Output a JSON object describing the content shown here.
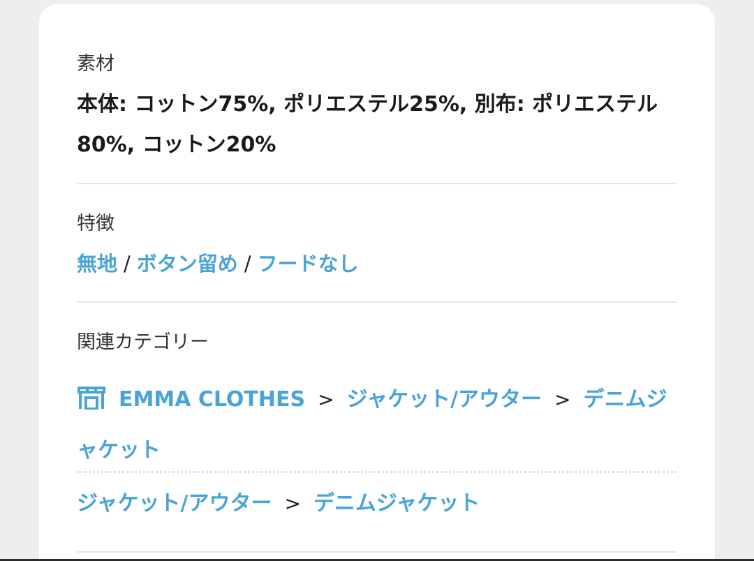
{
  "material": {
    "heading": "素材",
    "text": "本体: コットン75%, ポリエステル25%, 別布: ポリエステル80%, コットン20%"
  },
  "features": {
    "heading": "特徴",
    "tags": [
      "無地",
      "ボタン留め",
      "フードなし"
    ],
    "separator": "/"
  },
  "related": {
    "heading": "関連カテゴリー",
    "breadcrumb1": [
      "EMMA CLOTHES",
      "ジャケット/アウター",
      "デニムジャケット"
    ],
    "breadcrumb2": [
      "ジャケット/アウター",
      "デニムジャケット"
    ],
    "chevron": ">",
    "shop_icon": "shop-icon"
  },
  "colors": {
    "link": "#4aa3d6",
    "text": "#1a1a1a",
    "muted": "#333333",
    "divider": "#e6e6e6"
  }
}
